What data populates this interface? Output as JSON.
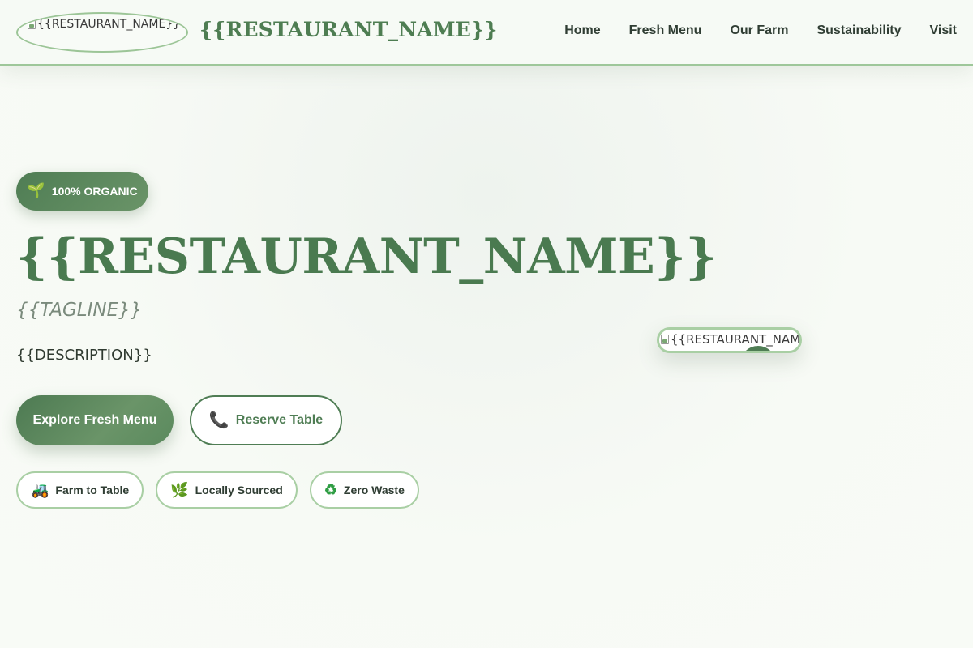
{
  "header": {
    "logo_alt": "{{RESTAURANT_NAME}} Logo",
    "brand_name": "{{RESTAURANT_NAME}}",
    "nav": [
      {
        "label": "Home"
      },
      {
        "label": "Fresh Menu"
      },
      {
        "label": "Our Farm"
      },
      {
        "label": "Sustainability"
      },
      {
        "label": "Visit"
      }
    ]
  },
  "hero": {
    "badge": {
      "icon": "sprout-icon",
      "label": "100% ORGANIC"
    },
    "title": "{{RESTAURANT_NAME}}",
    "tagline": "{{TAGLINE}}",
    "description": "{{DESCRIPTION}}",
    "primary_button": "Explore Fresh Menu",
    "secondary_button": {
      "icon": "phone-icon",
      "label": "Reserve Table"
    },
    "features": [
      {
        "icon": "tractor-icon",
        "label": "Farm to Table"
      },
      {
        "icon": "herb-icon",
        "label": "Locally Sourced"
      },
      {
        "icon": "recycle-icon",
        "label": "Zero Waste"
      }
    ],
    "image_alt": "{{RESTAURANT_NAME}}"
  },
  "colors": {
    "brand_green": "#4e7d52",
    "accent_green": "#9ec79a",
    "background": "#f7faf5"
  }
}
